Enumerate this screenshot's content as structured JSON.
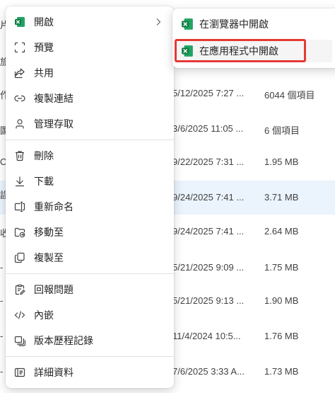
{
  "background_list": {
    "rows": [
      {
        "name": "片",
        "date": "",
        "size": "",
        "selected": false
      },
      {
        "name": "旅",
        "date": "",
        "size": "",
        "selected": false
      },
      {
        "name": "作",
        "date": "5/12/2025 7:27 ...",
        "size": "6044 個項目",
        "selected": false
      },
      {
        "name": "圖",
        "date": "3/6/2025 11:05 ...",
        "size": "6 個項目",
        "selected": false
      },
      {
        "name": "O",
        "date": "9/22/2025 7:31 ...",
        "size": "1.95 MB",
        "selected": false
      },
      {
        "name": "誤",
        "date": "9/24/2025 7:41 ...",
        "size": "3.71 MB",
        "selected": true
      },
      {
        "name": "收",
        "date": "9/24/2025 7:41 ...",
        "size": "2.64 MB",
        "selected": false
      },
      {
        "name": "-",
        "date": "5/21/2025 9:09 ...",
        "size": "1.75 MB",
        "selected": false
      },
      {
        "name": "-",
        "date": "5/21/2025 9:13 ...",
        "size": "1.90 MB",
        "selected": false
      },
      {
        "name": "-",
        "date": "11/4/2024 10:5...",
        "size": "1.76 MB",
        "selected": false
      },
      {
        "name": "-",
        "date": "7/6/2025 3:33 A...",
        "size": "1.73 MB",
        "selected": false
      }
    ]
  },
  "menu": {
    "open": "開啟",
    "preview": "預覽",
    "share": "共用",
    "copy_link": "複製連結",
    "manage_access": "管理存取",
    "delete": "刪除",
    "download": "下載",
    "rename": "重新命名",
    "move_to": "移動至",
    "copy_to": "複製至",
    "report": "回報問題",
    "embed": "內嵌",
    "version_history": "版本歷程記錄",
    "details": "詳細資料"
  },
  "submenu": {
    "open_in_browser": "在瀏覽器中開啟",
    "open_in_app": "在應用程式中開啟"
  },
  "colors": {
    "excel_green": "#107c41",
    "highlight_red": "#e53935",
    "selected_row": "#ebf3fc"
  }
}
